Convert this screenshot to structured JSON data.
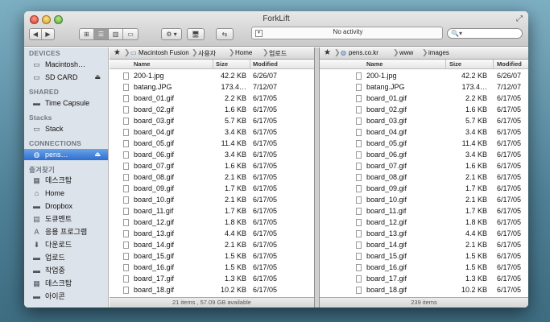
{
  "window": {
    "title": "ForkLift",
    "activity_text": "No activity",
    "search_placeholder": ""
  },
  "toolbar": {
    "back_icon": "◀",
    "forward_icon": "▶",
    "view_icon_glyph": "⊞",
    "view_list_glyph": "☰",
    "view_columns_glyph": "▥",
    "view_cover_glyph": "▭",
    "action_glyph": "⚙ ▾",
    "connect_glyph": "🖥",
    "sync_glyph": "⇆",
    "search_glyph": "🔍▾",
    "activity_check": "▾"
  },
  "sidebar": {
    "sections": [
      {
        "header": "DEVICES",
        "items": [
          {
            "label": "Macintosh…",
            "icon": "hdd-icon",
            "glyph": "▭",
            "eject": false,
            "selected": false
          },
          {
            "label": "SD CARD",
            "icon": "sdcard-icon",
            "glyph": "▭",
            "eject": true,
            "selected": false
          }
        ]
      },
      {
        "header": "SHARED",
        "items": [
          {
            "label": "Time Capsule",
            "icon": "time-capsule-icon",
            "glyph": "▬",
            "eject": false,
            "selected": false
          }
        ]
      },
      {
        "header": "Stacks",
        "items": [
          {
            "label": "Stack",
            "icon": "stack-icon",
            "glyph": "▭",
            "eject": false,
            "selected": false
          }
        ]
      },
      {
        "header": "CONNECTIONS",
        "items": [
          {
            "label": "pens…",
            "icon": "globe-icon",
            "glyph": "◍",
            "eject": true,
            "selected": true
          }
        ]
      },
      {
        "header": "즐겨찾기",
        "items": [
          {
            "label": "데스크탑",
            "icon": "desktop-folder-icon",
            "glyph": "▦",
            "eject": false,
            "selected": false
          },
          {
            "label": "Home",
            "icon": "home-icon",
            "glyph": "⌂",
            "eject": false,
            "selected": false
          },
          {
            "label": "Dropbox",
            "icon": "dropbox-folder-icon",
            "glyph": "▬",
            "eject": false,
            "selected": false
          },
          {
            "label": "도큐멘트",
            "icon": "documents-folder-icon",
            "glyph": "▤",
            "eject": false,
            "selected": false
          },
          {
            "label": "응용 프로그램",
            "icon": "applications-icon",
            "glyph": "A",
            "eject": false,
            "selected": false
          },
          {
            "label": "다운로드",
            "icon": "downloads-icon",
            "glyph": "⬇",
            "eject": false,
            "selected": false
          },
          {
            "label": "업로드",
            "icon": "folder-icon",
            "glyph": "▬",
            "eject": false,
            "selected": false
          },
          {
            "label": "작업중",
            "icon": "folder-icon",
            "glyph": "▬",
            "eject": false,
            "selected": false
          },
          {
            "label": "데스크탑",
            "icon": "desktop-folder-icon",
            "glyph": "▦",
            "eject": false,
            "selected": false
          },
          {
            "label": "아이콘",
            "icon": "folder-icon",
            "glyph": "▬",
            "eject": false,
            "selected": false
          }
        ]
      }
    ]
  },
  "columns": {
    "name": "Name",
    "size": "Size",
    "modified": "Modified"
  },
  "left_pane": {
    "star": "★",
    "breadcrumbs": [
      "Macintosh Fusion",
      "사용자",
      "Home",
      "업로드"
    ],
    "status": "21 items , 57.09 GB available",
    "files": [
      {
        "name": "200-1.jpg",
        "size": "42.2 KB",
        "modified": "6/26/07"
      },
      {
        "name": "batang.JPG",
        "size": "173.4…",
        "modified": "7/12/07"
      },
      {
        "name": "board_01.gif",
        "size": "2.2 KB",
        "modified": "6/17/05"
      },
      {
        "name": "board_02.gif",
        "size": "1.6 KB",
        "modified": "6/17/05"
      },
      {
        "name": "board_03.gif",
        "size": "5.7 KB",
        "modified": "6/17/05"
      },
      {
        "name": "board_04.gif",
        "size": "3.4 KB",
        "modified": "6/17/05"
      },
      {
        "name": "board_05.gif",
        "size": "11.4 KB",
        "modified": "6/17/05"
      },
      {
        "name": "board_06.gif",
        "size": "3.4 KB",
        "modified": "6/17/05"
      },
      {
        "name": "board_07.gif",
        "size": "1.6 KB",
        "modified": "6/17/05"
      },
      {
        "name": "board_08.gif",
        "size": "2.1 KB",
        "modified": "6/17/05"
      },
      {
        "name": "board_09.gif",
        "size": "1.7 KB",
        "modified": "6/17/05"
      },
      {
        "name": "board_10.gif",
        "size": "2.1 KB",
        "modified": "6/17/05"
      },
      {
        "name": "board_11.gif",
        "size": "1.7 KB",
        "modified": "6/17/05"
      },
      {
        "name": "board_12.gif",
        "size": "1.8 KB",
        "modified": "6/17/05"
      },
      {
        "name": "board_13.gif",
        "size": "4.4 KB",
        "modified": "6/17/05"
      },
      {
        "name": "board_14.gif",
        "size": "2.1 KB",
        "modified": "6/17/05"
      },
      {
        "name": "board_15.gif",
        "size": "1.5 KB",
        "modified": "6/17/05"
      },
      {
        "name": "board_16.gif",
        "size": "1.5 KB",
        "modified": "6/17/05"
      },
      {
        "name": "board_17.gif",
        "size": "1.3 KB",
        "modified": "6/17/05"
      },
      {
        "name": "board_18.gif",
        "size": "10.2 KB",
        "modified": "6/17/05"
      }
    ]
  },
  "right_pane": {
    "star": "★",
    "breadcrumbs": [
      "pens.co.kr",
      "www",
      "images"
    ],
    "status": "239 items",
    "files": [
      {
        "name": "200-1.jpg",
        "size": "42.2 KB",
        "modified": "6/26/07"
      },
      {
        "name": "batang.JPG",
        "size": "173.4…",
        "modified": "7/12/07"
      },
      {
        "name": "board_01.gif",
        "size": "2.2 KB",
        "modified": "6/17/05"
      },
      {
        "name": "board_02.gif",
        "size": "1.6 KB",
        "modified": "6/17/05"
      },
      {
        "name": "board_03.gif",
        "size": "5.7 KB",
        "modified": "6/17/05"
      },
      {
        "name": "board_04.gif",
        "size": "3.4 KB",
        "modified": "6/17/05"
      },
      {
        "name": "board_05.gif",
        "size": "11.4 KB",
        "modified": "6/17/05"
      },
      {
        "name": "board_06.gif",
        "size": "3.4 KB",
        "modified": "6/17/05"
      },
      {
        "name": "board_07.gif",
        "size": "1.6 KB",
        "modified": "6/17/05"
      },
      {
        "name": "board_08.gif",
        "size": "2.1 KB",
        "modified": "6/17/05"
      },
      {
        "name": "board_09.gif",
        "size": "1.7 KB",
        "modified": "6/17/05"
      },
      {
        "name": "board_10.gif",
        "size": "2.1 KB",
        "modified": "6/17/05"
      },
      {
        "name": "board_11.gif",
        "size": "1.7 KB",
        "modified": "6/17/05"
      },
      {
        "name": "board_12.gif",
        "size": "1.8 KB",
        "modified": "6/17/05"
      },
      {
        "name": "board_13.gif",
        "size": "4.4 KB",
        "modified": "6/17/05"
      },
      {
        "name": "board_14.gif",
        "size": "2.1 KB",
        "modified": "6/17/05"
      },
      {
        "name": "board_15.gif",
        "size": "1.5 KB",
        "modified": "6/17/05"
      },
      {
        "name": "board_16.gif",
        "size": "1.5 KB",
        "modified": "6/17/05"
      },
      {
        "name": "board_17.gif",
        "size": "1.3 KB",
        "modified": "6/17/05"
      },
      {
        "name": "board_18.gif",
        "size": "10.2 KB",
        "modified": "6/17/05"
      }
    ]
  },
  "colors": {
    "selection": "#2e6fd1",
    "sidebar_bg": "#dde3ea",
    "sidebar_header": "#6f7a86"
  }
}
